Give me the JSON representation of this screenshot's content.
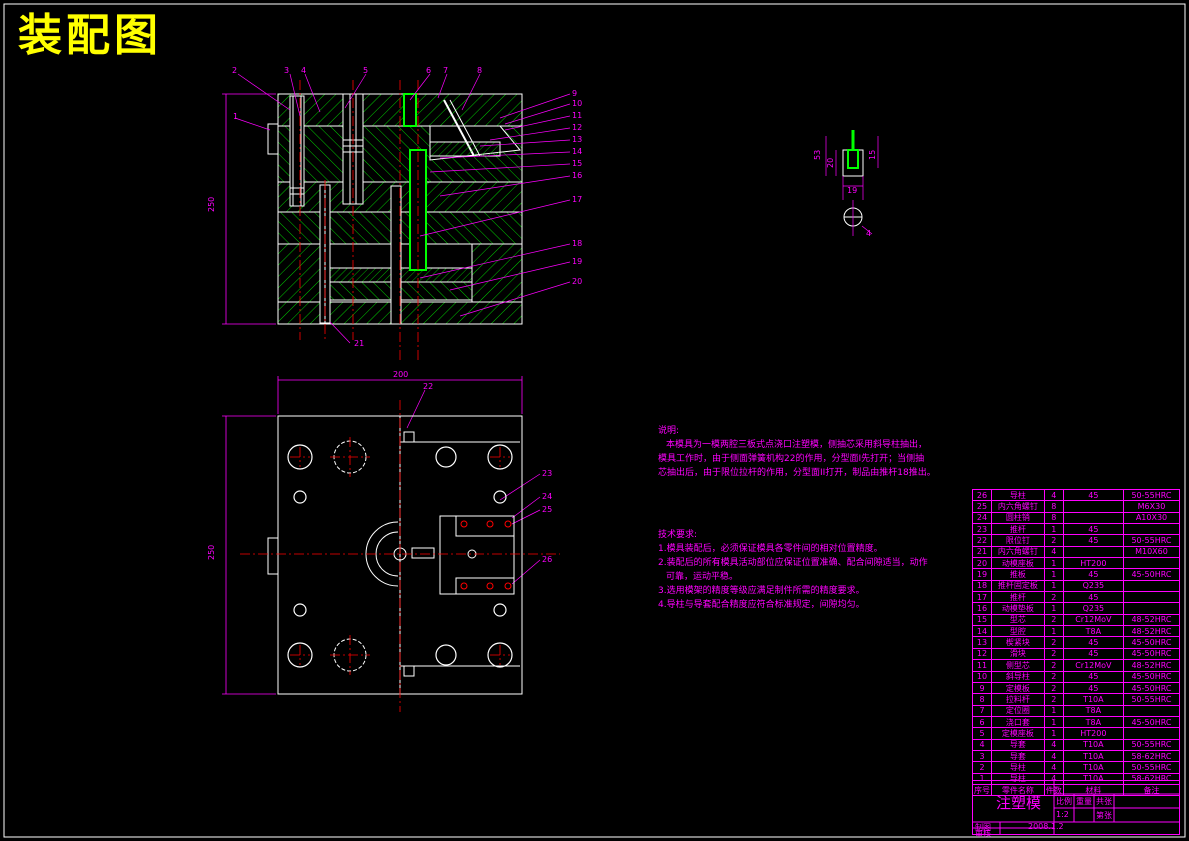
{
  "title": "装配图",
  "part_labels": [
    "1",
    "2",
    "3",
    "4",
    "5",
    "6",
    "7",
    "8",
    "9",
    "10",
    "11",
    "12",
    "13",
    "14",
    "15",
    "16",
    "17",
    "18",
    "19",
    "20",
    "21",
    "22",
    "23",
    "24",
    "25",
    "26"
  ],
  "dimensions": {
    "front_height": "250",
    "top_width": "200",
    "top_height": "250",
    "detail_w": "19",
    "detail_h1": "53",
    "detail_h2": "15",
    "detail_h3": "20",
    "detail_r": "4"
  },
  "notes": {
    "heading": "说明:",
    "lines": [
      "本模具为一模两腔三板式点浇口注塑模，侧抽芯采用斜导柱抽出，",
      "模具工作时，由于侧面弹簧机构22的作用，分型面I先打开；当侧抽",
      "芯抽出后，由于限位拉杆的作用，分型面II打开，制品由推杆18推出。"
    ],
    "tech_heading": "技术要求:",
    "tech_lines": [
      "1.模具装配后，必须保证模具各零件间的相对位置精度。",
      "2.装配后的所有模具活动部位应保证位置准确、配合间隙适当，动作",
      "可靠，运动平稳。",
      "3.选用模架的精度等级应满足制件所需的精度要求。",
      "4.导柱与导套配合精度应符合标准规定，间隙均匀。"
    ]
  },
  "bom": [
    [
      "26",
      "导柱",
      "4",
      "45",
      "50-55HRC"
    ],
    [
      "25",
      "内六角螺钉",
      "8",
      "",
      "M6X30"
    ],
    [
      "24",
      "圆柱销",
      "8",
      "",
      "A10X30"
    ],
    [
      "23",
      "推杆",
      "1",
      "45",
      ""
    ],
    [
      "22",
      "限位钉",
      "2",
      "45",
      "50-55HRC"
    ],
    [
      "21",
      "内六角螺钉",
      "4",
      "",
      "M10X60"
    ],
    [
      "20",
      "动模座板",
      "1",
      "HT200",
      ""
    ],
    [
      "19",
      "推板",
      "1",
      "45",
      "45-50HRC"
    ],
    [
      "18",
      "推杆固定板",
      "1",
      "Q235",
      ""
    ],
    [
      "17",
      "推杆",
      "2",
      "45",
      ""
    ],
    [
      "16",
      "动模垫板",
      "1",
      "Q235",
      ""
    ],
    [
      "15",
      "型芯",
      "2",
      "Cr12MoV",
      "48-52HRC"
    ],
    [
      "14",
      "型腔",
      "1",
      "T8A",
      "48-52HRC"
    ],
    [
      "13",
      "楔紧块",
      "2",
      "45",
      "45-50HRC"
    ],
    [
      "12",
      "滑块",
      "2",
      "45",
      "45-50HRC"
    ],
    [
      "11",
      "侧型芯",
      "2",
      "Cr12MoV",
      "48-52HRC"
    ],
    [
      "10",
      "斜导柱",
      "2",
      "45",
      "45-50HRC"
    ],
    [
      "9",
      "定模板",
      "2",
      "45",
      "45-50HRC"
    ],
    [
      "8",
      "拉料杆",
      "2",
      "T10A",
      "50-55HRC"
    ],
    [
      "7",
      "定位圈",
      "1",
      "T8A",
      ""
    ],
    [
      "6",
      "浇口套",
      "1",
      "T8A",
      "45-50HRC"
    ],
    [
      "5",
      "定模座板",
      "1",
      "HT200",
      ""
    ],
    [
      "4",
      "导套",
      "4",
      "T10A",
      "50-55HRC"
    ],
    [
      "3",
      "导套",
      "4",
      "T10A",
      "58-62HRC"
    ],
    [
      "2",
      "导柱",
      "4",
      "T10A",
      "50-55HRC"
    ],
    [
      "1",
      "导柱",
      "4",
      "T10A",
      "58-62HRC"
    ]
  ],
  "bom_header": [
    "序号",
    "零件名称",
    "件数",
    "材料",
    "备注"
  ],
  "title_block": {
    "name": "注塑模",
    "scale_label": "比例",
    "scale": "1:2",
    "sheet_label": "图号",
    "drawn_label": "制图",
    "date": "2008.1.2",
    "check_label": "审核",
    "weight_label": "重量",
    "quantity_label": "共张",
    "page_label": "第张"
  },
  "colors": {
    "bg": "#000000",
    "outline": "#ffffff",
    "hatch": "#00ff00",
    "label": "#ff00ff",
    "title": "#ffff00",
    "center": "#ff0000",
    "cyan": "#00ffff"
  }
}
